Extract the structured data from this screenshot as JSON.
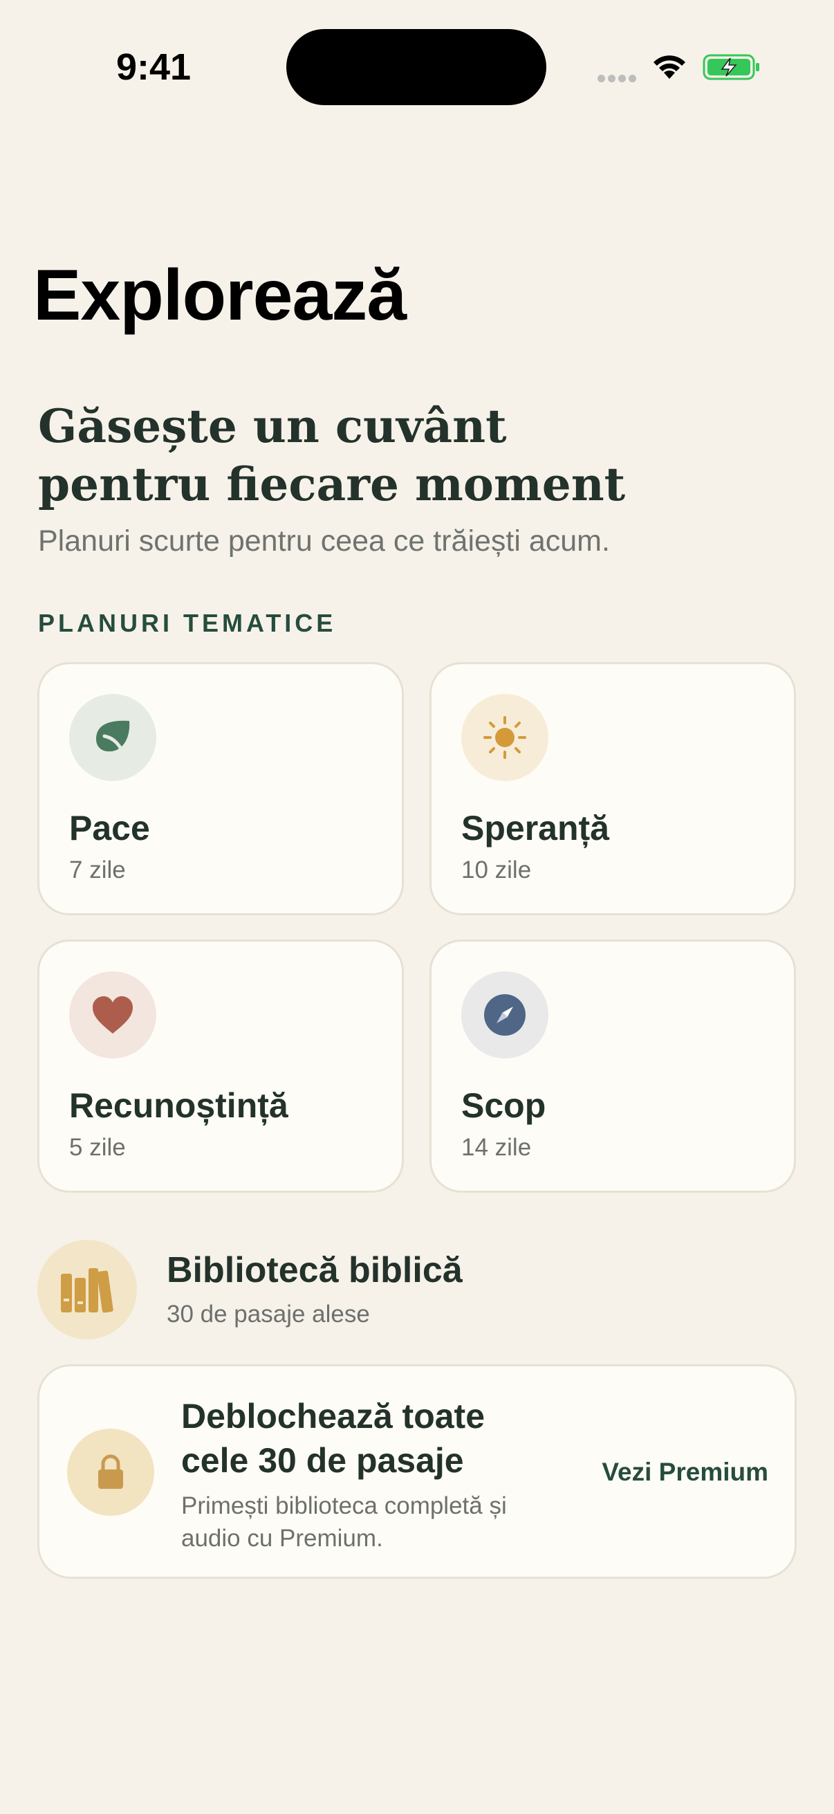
{
  "status_bar": {
    "time": "9:41"
  },
  "page": {
    "title": "Explorează"
  },
  "hero": {
    "heading": "Găsește un cuvânt pentru fiecare moment",
    "subtitle": "Planuri scurte pentru ceea ce trăiești acum."
  },
  "themes": {
    "section_label": "PLANURI TEMATICE",
    "items": [
      {
        "title": "Pace",
        "duration": "7 zile",
        "icon": "leaf-icon",
        "icon_color": "#4a7a5f",
        "icon_bg": "#e6ebe4"
      },
      {
        "title": "Speranță",
        "duration": "10 zile",
        "icon": "sun-icon",
        "icon_color": "#d49a3a",
        "icon_bg": "#f7ecd8"
      },
      {
        "title": "Recunoștință",
        "duration": "5 zile",
        "icon": "heart-icon",
        "icon_color": "#ad5d4b",
        "icon_bg": "#f3e6df"
      },
      {
        "title": "Scop",
        "duration": "14 zile",
        "icon": "compass-icon",
        "icon_color": "#4f6687",
        "icon_bg": "#e9e9ea"
      }
    ]
  },
  "library": {
    "title": "Bibliotecă biblică",
    "subtitle": "30 de pasaje alese",
    "icon": "books-icon",
    "icon_color": "#cf9d45"
  },
  "premium": {
    "title": "Deblochează toate cele 30 de pasaje",
    "description": "Primești biblioteca completă și audio cu Premium.",
    "link": "Vezi Premium",
    "icon": "lock-icon",
    "icon_color": "#c99a4d"
  },
  "colors": {
    "background": "#f6f2e9",
    "card": "#fefcf6",
    "accent_green": "#264c3d"
  }
}
